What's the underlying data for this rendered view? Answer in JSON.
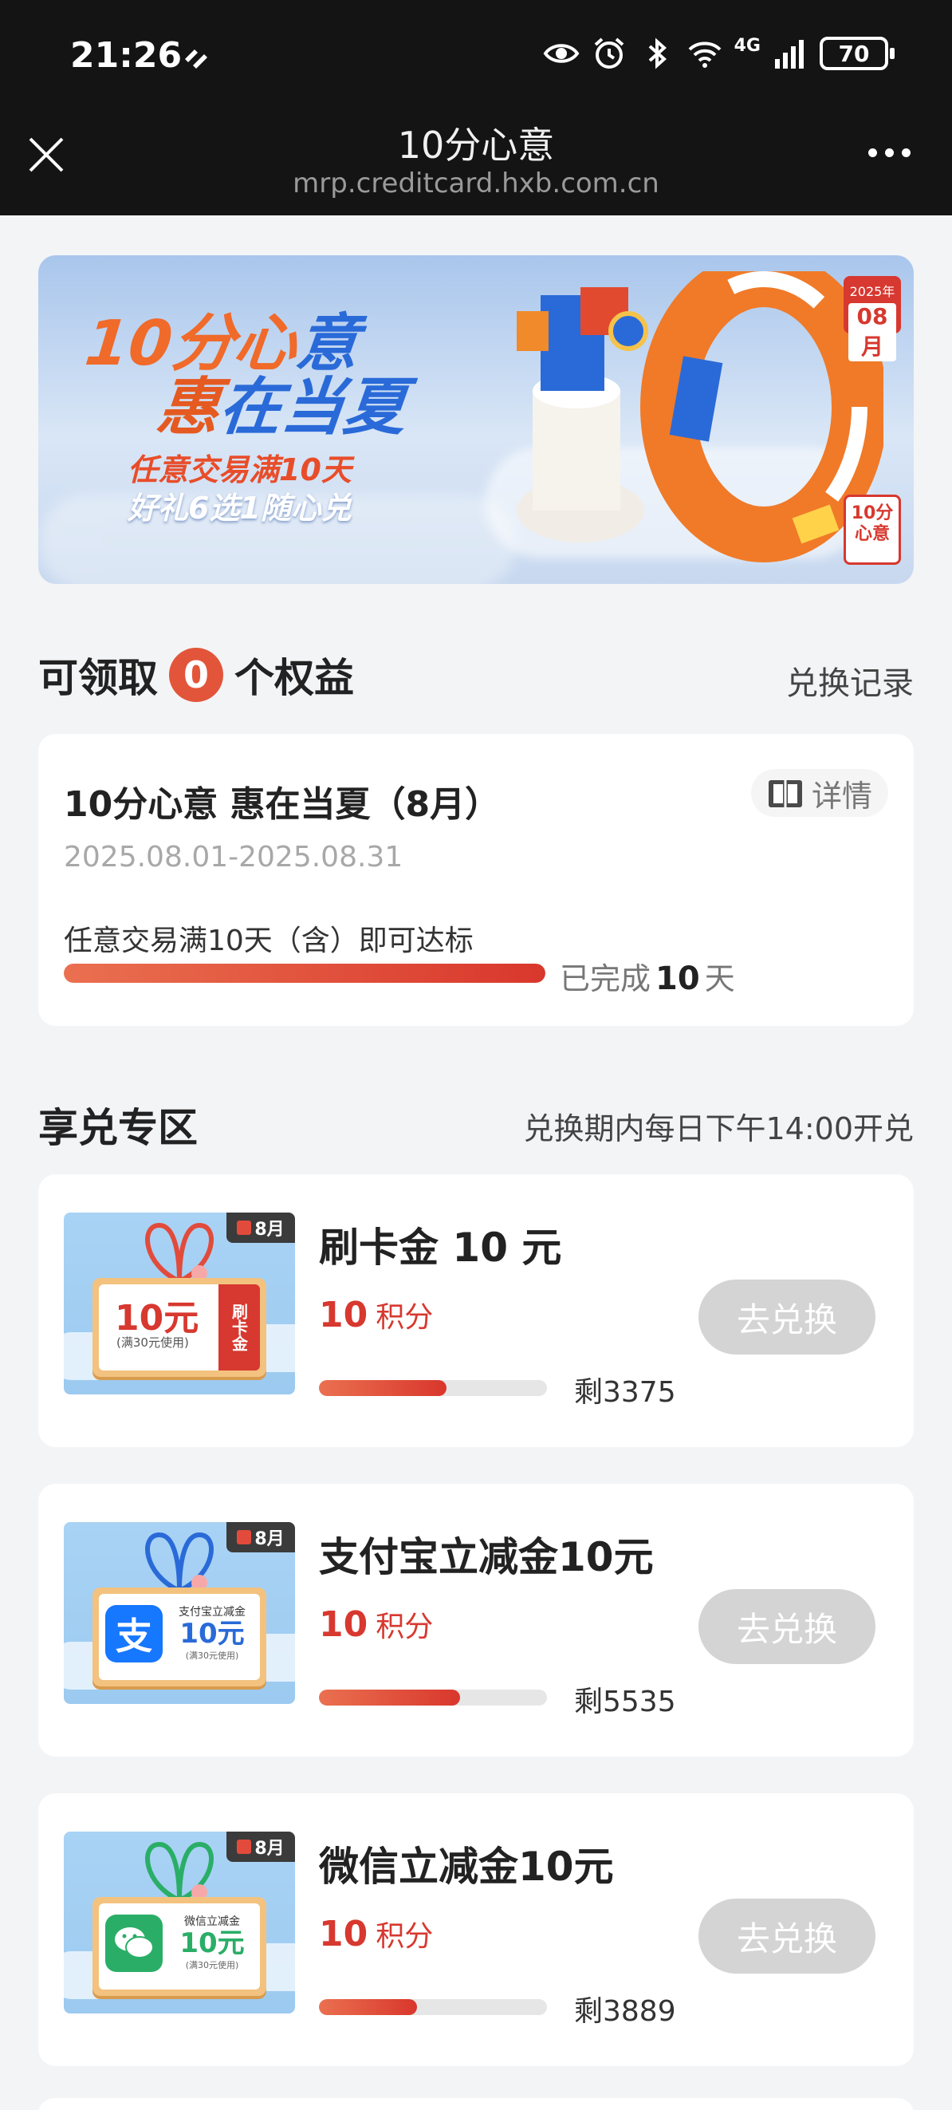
{
  "status_bar": {
    "time": "21:26",
    "network": "4G",
    "battery": "70"
  },
  "titlebar": {
    "title": "10分心意",
    "url": "mrp.creditcard.hxb.com.cn"
  },
  "banner": {
    "line1_a": "10分心",
    "line1_b": "意",
    "line2_a": "惠",
    "line2_b": "在当夏",
    "sub1": "任意交易满10天",
    "sub2": "好礼6选1随心兑",
    "date_year": "2025年",
    "date_month": "08月",
    "seal": "10分心意"
  },
  "benefits": {
    "prefix": "可领取",
    "count": "0",
    "suffix": "个权益",
    "record_link": "兑换记录"
  },
  "activity": {
    "title": "10分心意 惠在当夏（8月）",
    "detail_label": "详情",
    "dates": "2025.08.01-2025.08.31",
    "rule": "任意交易满10天（含）即可达标",
    "progress": 1.0,
    "done_prefix": "已完成",
    "done_days": "10",
    "done_suffix": "天"
  },
  "exchange": {
    "title": "享兑专区",
    "note": "兑换期内每日下午14:00开兑",
    "items": [
      {
        "title": "刷卡金 10 元",
        "points": "10",
        "points_unit": "积分",
        "remaining": "剩3375",
        "progress": 0.56,
        "button": "去兑换",
        "thumb": {
          "month": "8月",
          "amount": "10元",
          "amount_note": "(满30元使用)",
          "side": "刷卡金"
        }
      },
      {
        "title": "支付宝立减金10元",
        "points": "10",
        "points_unit": "积分",
        "remaining": "剩5535",
        "progress": 0.62,
        "button": "去兑换",
        "thumb": {
          "month": "8月",
          "logo": "支",
          "label": "支付宝立减金",
          "amount": "10元",
          "amount_note": "(满30元使用)",
          "logo_color": "#1677ff"
        }
      },
      {
        "title": "微信立减金10元",
        "points": "10",
        "points_unit": "积分",
        "remaining": "剩3889",
        "progress": 0.43,
        "button": "去兑换",
        "thumb": {
          "month": "8月",
          "label": "微信立减金",
          "amount": "10元",
          "amount_note": "(满30元使用)",
          "logo_color": "#2aae67"
        }
      }
    ]
  },
  "colors": {
    "accent": "#d7382f",
    "badge": "#e2553a",
    "button_disabled": "#d4d4d4"
  }
}
